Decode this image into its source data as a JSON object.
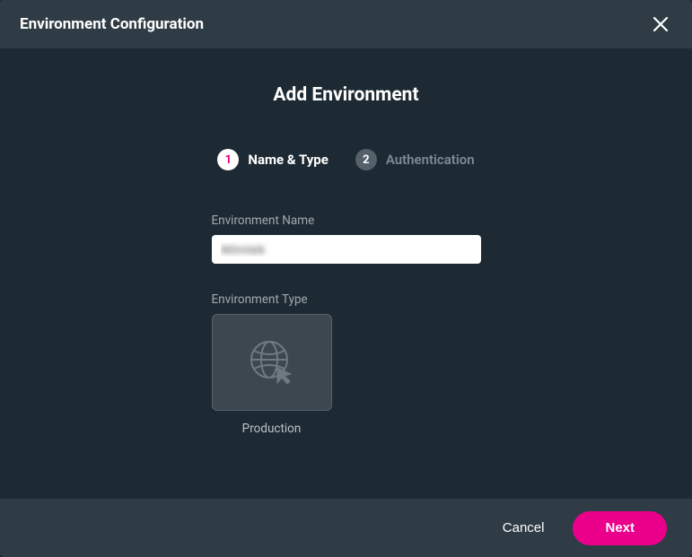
{
  "header": {
    "title": "Environment Configuration"
  },
  "body": {
    "title": "Add Environment",
    "steps": [
      {
        "number": "1",
        "label": "Name & Type",
        "active": true
      },
      {
        "number": "2",
        "label": "Authentication",
        "active": false
      }
    ],
    "form": {
      "name_label": "Environment Name",
      "name_value": "Winniek",
      "type_label": "Environment Type",
      "type_option": "Production"
    }
  },
  "footer": {
    "cancel_label": "Cancel",
    "next_label": "Next"
  },
  "colors": {
    "accent": "#eb008b",
    "surface": "#303c45",
    "background": "#1e2a33"
  }
}
